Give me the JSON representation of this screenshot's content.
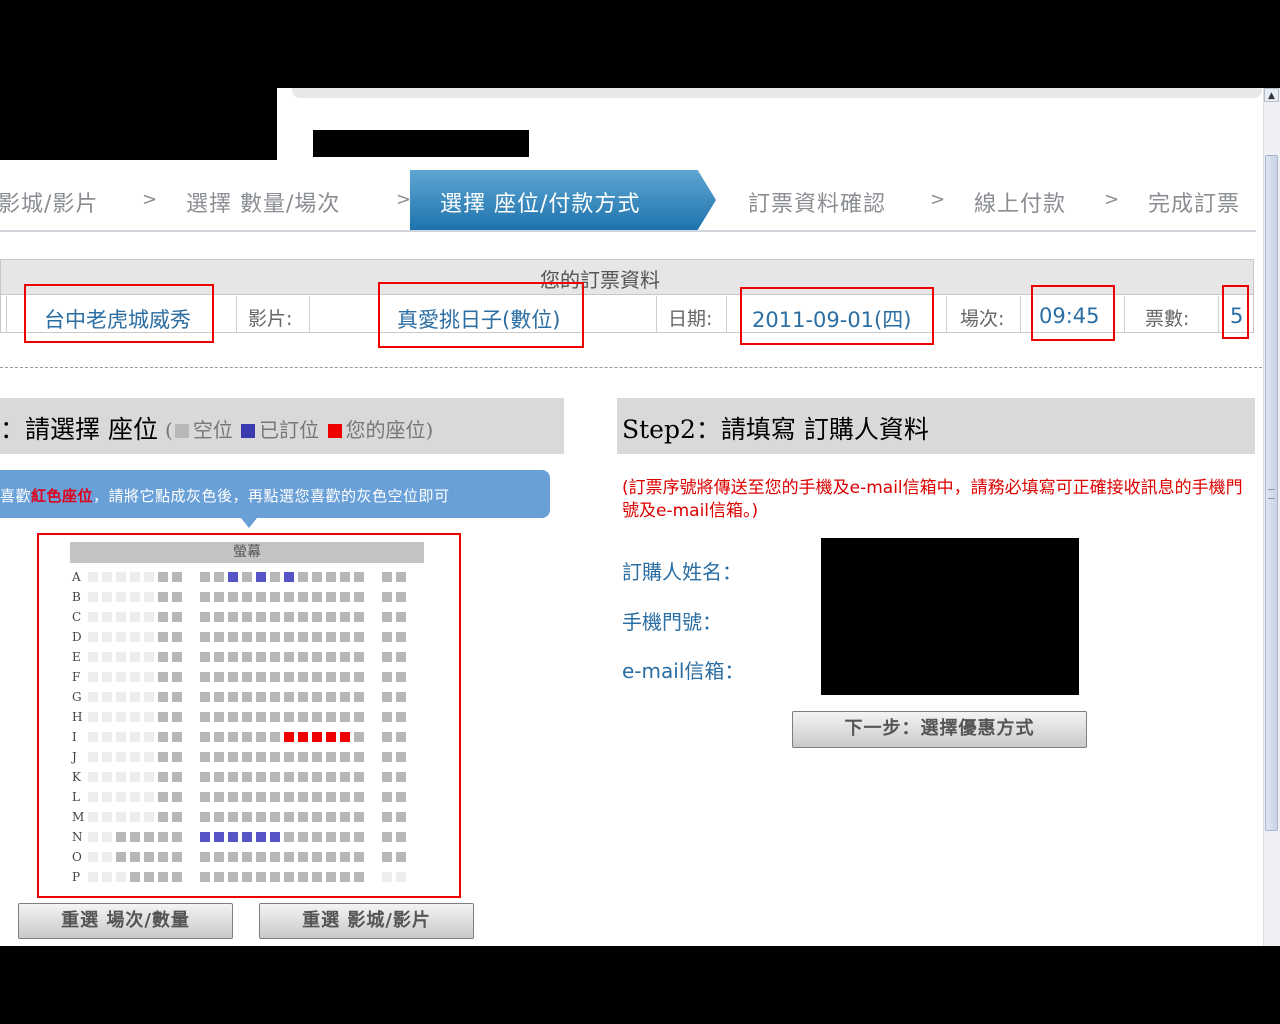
{
  "steps": {
    "s1": "影城/影片",
    "s2": "選擇  數量/場次",
    "s3": "選擇  座位/付款方式",
    "s4": "訂票資料確認",
    "s5": "線上付款",
    "s6": "完成訂票",
    "sep": ">"
  },
  "info": {
    "title": "您的訂票資料",
    "cinema": "台中老虎城威秀",
    "movie_label": "影片:",
    "movie": "真愛挑日子(數位)",
    "date_label": "日期:",
    "date": "2011-09-01(四)",
    "time_label": "場次:",
    "time": "09:45",
    "count_label": "票數:",
    "count": "5"
  },
  "seats": {
    "title": "：請選擇 座位",
    "legend_open": "(",
    "legend_empty": "空位",
    "legend_booked": "已訂位",
    "legend_mine": "您的座位",
    "legend_close": ")",
    "hint_prefix": "喜歡",
    "hint_red": "紅色座位",
    "hint_suffix": "，請將它點成灰色後，再點選您喜歡的灰色空位即可",
    "screen": "螢幕",
    "rows": [
      "A",
      "B",
      "C",
      "D",
      "E",
      "F",
      "G",
      "H",
      "I",
      "J",
      "K",
      "L",
      "M",
      "N",
      "O",
      "P"
    ],
    "colors": {
      "empty": "#b7b7b7",
      "booked": "#5555c8",
      "mine": "#ee0000"
    },
    "reselect_time_button": "重選  場次/數量",
    "reselect_cinema_button": "重選  影城/影片"
  },
  "buyer": {
    "title": "Step2：請填寫 訂購人資料",
    "note": "(訂票序號將傳送至您的手機及e-mail信箱中，請務必填寫可正確接收訊息的手機門號及e-mail信箱。)",
    "name_label": "訂購人姓名：",
    "phone_label": "手機門號：",
    "email_label": "e-mail信箱：",
    "next_button": "下一步：選擇優惠方式"
  }
}
